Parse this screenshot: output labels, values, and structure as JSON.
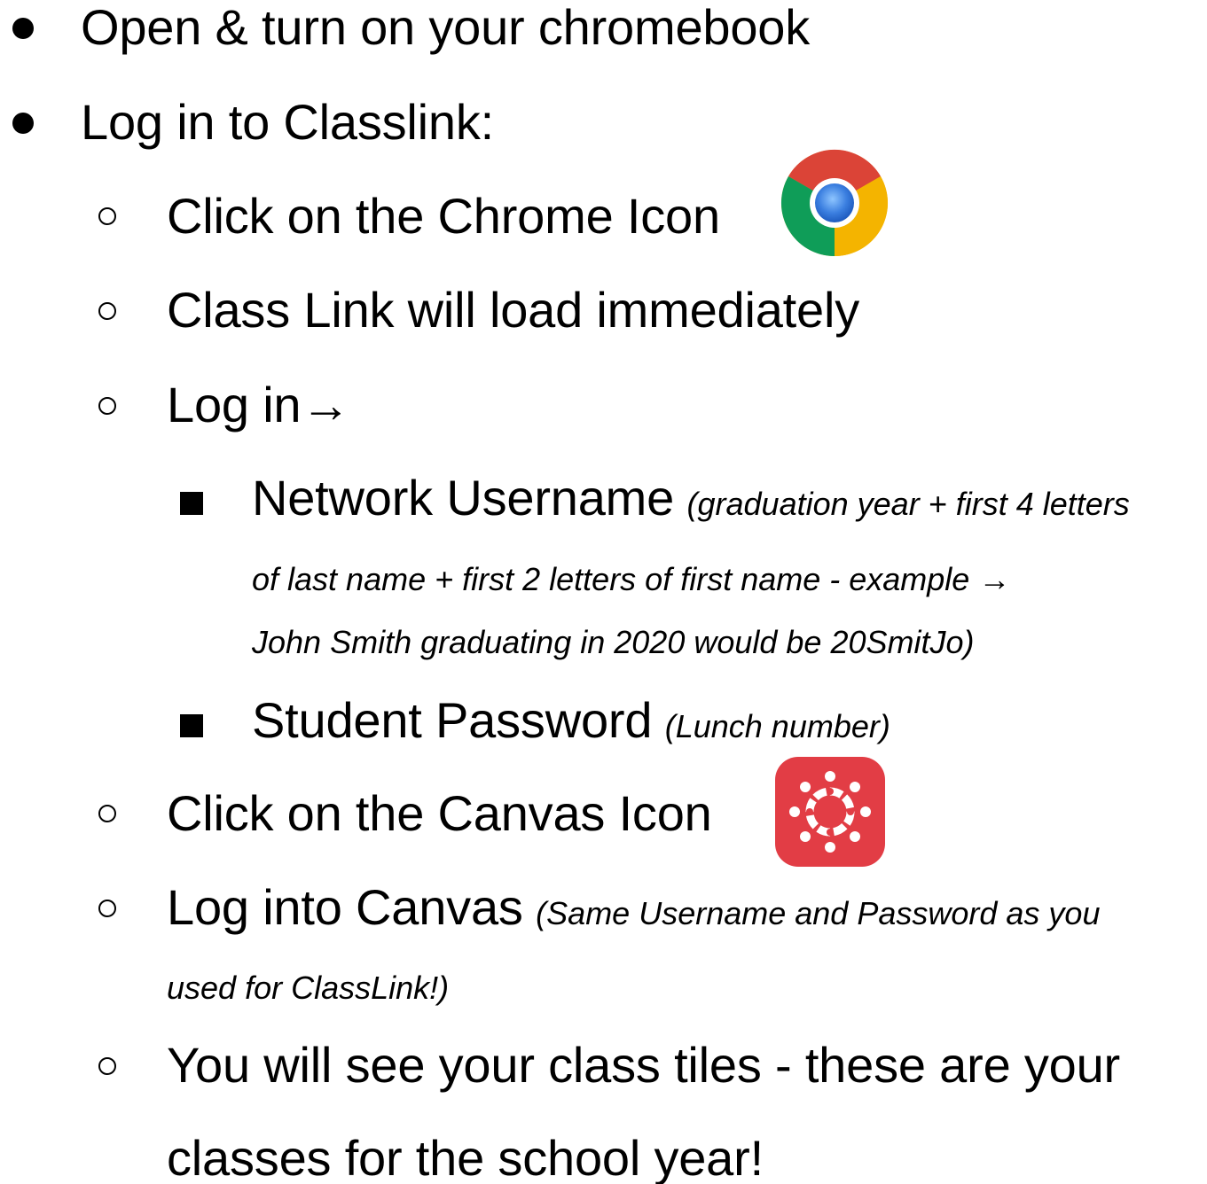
{
  "items": {
    "open_chromebook": "Open & turn on your chromebook",
    "log_in_classlink": "Log in to Classlink:",
    "click_chrome": "Click on the Chrome Icon",
    "classlink_loads": "Class Link will load immediately",
    "log_in_arrow": "Log in→",
    "network_username": "Network Username",
    "network_username_note_1": "(graduation year + first 4 letters",
    "network_username_note_2": "of last name + first 2 letters of first name - example →",
    "network_username_note_3": "John Smith graduating in 2020 would be 20SmitJo)",
    "student_password": "Student Password",
    "student_password_note": "(Lunch number)",
    "click_canvas": "Click on the Canvas Icon",
    "log_into_canvas": "Log into Canvas",
    "log_into_canvas_note_1": "(Same Username and Password as you",
    "log_into_canvas_note_2": "used for ClassLink!)",
    "class_tiles_1": "You will see your class tiles - these are your",
    "class_tiles_2": "classes for the school year!"
  },
  "icons": {
    "chrome": "chrome-icon",
    "canvas": "canvas-icon"
  },
  "colors": {
    "canvas_red": "#E23D45",
    "chrome_red": "#DB4437",
    "chrome_green": "#0F9D58",
    "chrome_yellow": "#F4B400",
    "chrome_blue": "#4285F4"
  }
}
